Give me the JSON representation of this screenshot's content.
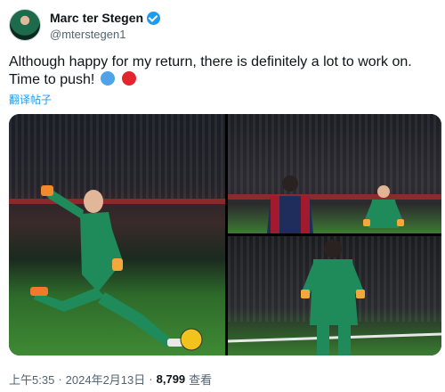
{
  "author": {
    "display_name": "Marc ter Stegen",
    "handle": "@mterstegen1",
    "verified_icon": "verified-badge-icon",
    "verified_color": "#1d9bf0"
  },
  "tweet": {
    "text": "Although happy for my return, there is definitely a lot to work on.  Time to push!",
    "emojis": [
      "blue-circle-icon",
      "red-circle-icon"
    ],
    "translate_label": "翻译帖子"
  },
  "media": {
    "photo_count": 3
  },
  "meta": {
    "time": "上午5:35",
    "separator": "·",
    "date": "2024年2月13日",
    "separator2": "·",
    "views": "8,799",
    "views_label": "查看"
  }
}
